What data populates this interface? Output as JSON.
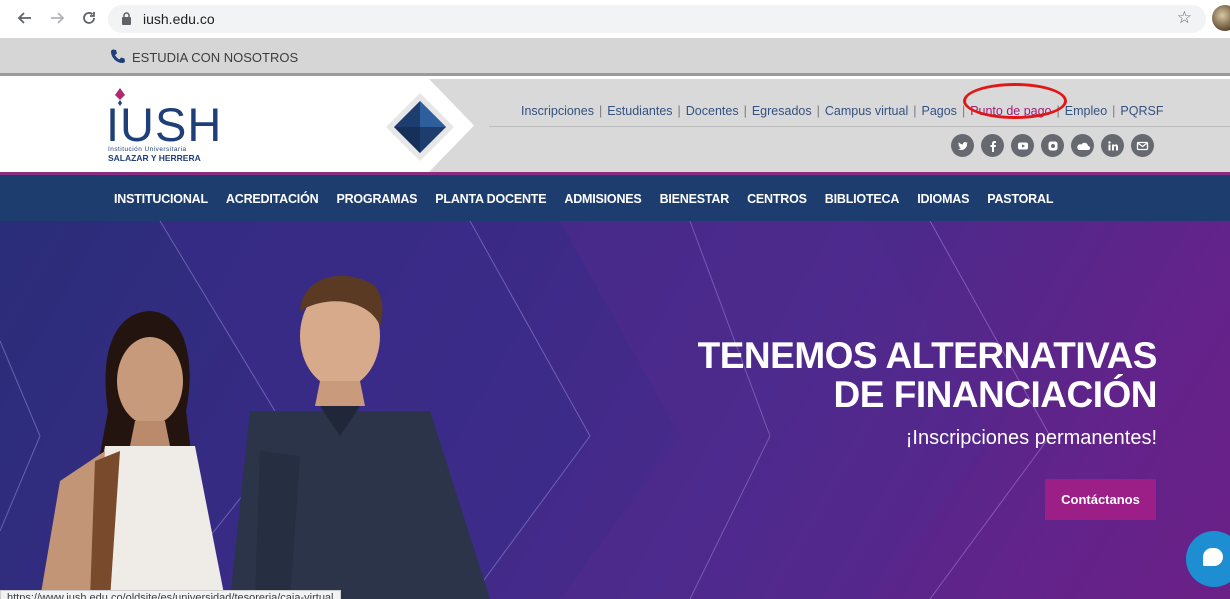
{
  "browser": {
    "url": "iush.edu.co",
    "status_url": "https://www.iush.edu.co/oldsite/es/universidad/tesoreria/caja-virtual"
  },
  "util_bar": {
    "link": "ESTUDIA CON NOSOTROS"
  },
  "logo": {
    "text": "IUSH",
    "line1": "Institución Universitaria",
    "line2": "SALAZAR Y HERRERA"
  },
  "top_links": [
    {
      "label": "Inscripciones"
    },
    {
      "label": "Estudiantes"
    },
    {
      "label": "Docentes"
    },
    {
      "label": "Egresados"
    },
    {
      "label": "Campus virtual"
    },
    {
      "label": "Pagos"
    },
    {
      "label": "Punto de pago"
    },
    {
      "label": "Empleo"
    },
    {
      "label": "PQRSF"
    }
  ],
  "socials": [
    "twitter-icon",
    "facebook-icon",
    "youtube-icon",
    "instagram-icon",
    "soundcloud-icon",
    "linkedin-icon",
    "mail-icon"
  ],
  "main_nav": [
    "INSTITUCIONAL",
    "ACREDITACIÓN",
    "PROGRAMAS",
    "PLANTA DOCENTE",
    "ADMISIONES",
    "BIENESTAR",
    "CENTROS",
    "BIBLIOTECA",
    "IDIOMAS",
    "PASTORAL"
  ],
  "hero": {
    "title_line1": "TENEMOS ALTERNATIVAS",
    "title_line2": "DE FINANCIACIÓN",
    "subtitle": "¡Inscripciones permanentes!",
    "cta": "Contáctanos"
  },
  "colors": {
    "nav_bg": "#1d3d6f",
    "accent": "#9b1f86",
    "link": "#355180",
    "highlight_link": "#a01c7a",
    "annotation": "#e01818"
  }
}
